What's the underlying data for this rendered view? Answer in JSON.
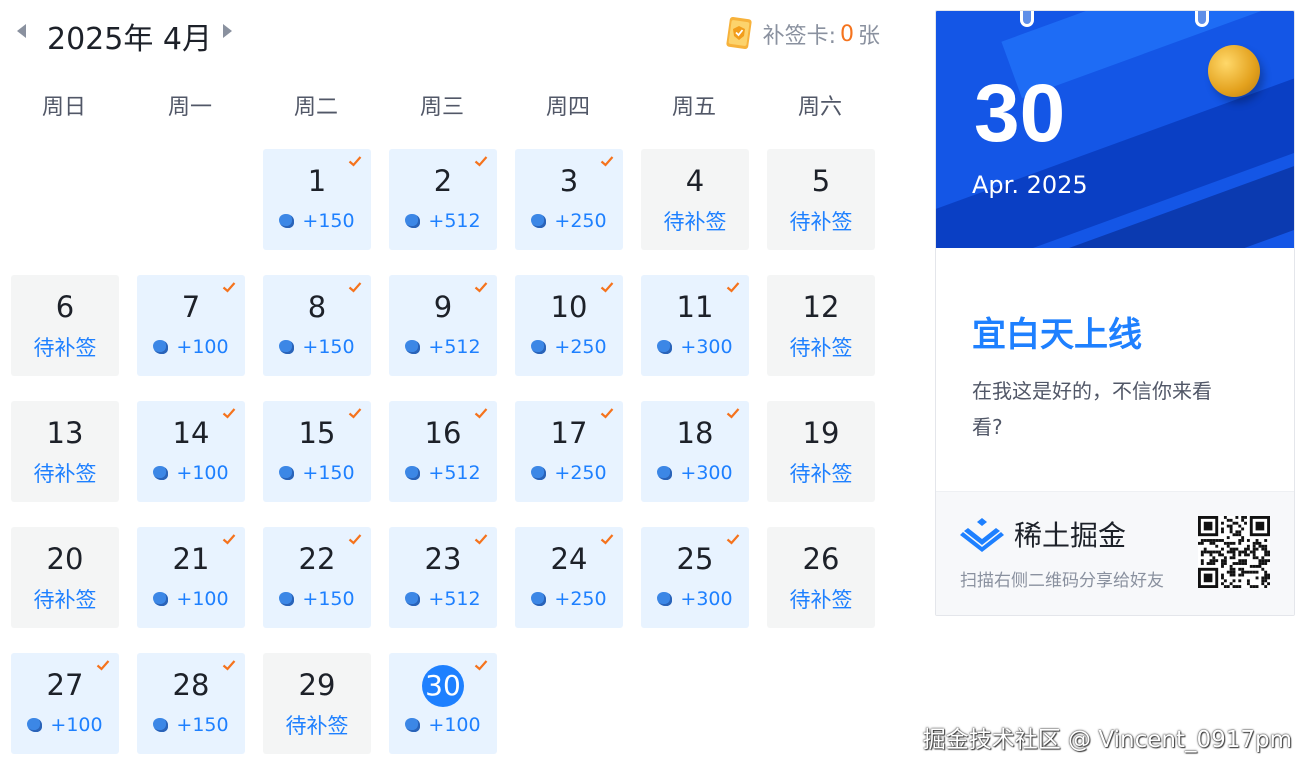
{
  "header": {
    "month_title": "2025年 4月",
    "makeup_label": "补签卡:",
    "makeup_count": "0",
    "makeup_unit": "张"
  },
  "weekdays": [
    "周日",
    "周一",
    "周二",
    "周三",
    "周四",
    "周五",
    "周六"
  ],
  "days": [
    {
      "day": "1",
      "status": "signed",
      "reward": "+150"
    },
    {
      "day": "2",
      "status": "signed",
      "reward": "+512"
    },
    {
      "day": "3",
      "status": "signed",
      "reward": "+250"
    },
    {
      "day": "4",
      "status": "pending",
      "label": "待补签"
    },
    {
      "day": "5",
      "status": "pending",
      "label": "待补签"
    },
    {
      "day": "6",
      "status": "pending",
      "label": "待补签"
    },
    {
      "day": "7",
      "status": "signed",
      "reward": "+100"
    },
    {
      "day": "8",
      "status": "signed",
      "reward": "+150"
    },
    {
      "day": "9",
      "status": "signed",
      "reward": "+512"
    },
    {
      "day": "10",
      "status": "signed",
      "reward": "+250"
    },
    {
      "day": "11",
      "status": "signed",
      "reward": "+300"
    },
    {
      "day": "12",
      "status": "pending",
      "label": "待补签"
    },
    {
      "day": "13",
      "status": "pending",
      "label": "待补签"
    },
    {
      "day": "14",
      "status": "signed",
      "reward": "+100"
    },
    {
      "day": "15",
      "status": "signed",
      "reward": "+150"
    },
    {
      "day": "16",
      "status": "signed",
      "reward": "+512"
    },
    {
      "day": "17",
      "status": "signed",
      "reward": "+250"
    },
    {
      "day": "18",
      "status": "signed",
      "reward": "+300"
    },
    {
      "day": "19",
      "status": "pending",
      "label": "待补签"
    },
    {
      "day": "20",
      "status": "pending",
      "label": "待补签"
    },
    {
      "day": "21",
      "status": "signed",
      "reward": "+100"
    },
    {
      "day": "22",
      "status": "signed",
      "reward": "+150"
    },
    {
      "day": "23",
      "status": "signed",
      "reward": "+512"
    },
    {
      "day": "24",
      "status": "signed",
      "reward": "+250"
    },
    {
      "day": "25",
      "status": "signed",
      "reward": "+300"
    },
    {
      "day": "26",
      "status": "pending",
      "label": "待补签"
    },
    {
      "day": "27",
      "status": "signed",
      "reward": "+100"
    },
    {
      "day": "28",
      "status": "signed",
      "reward": "+150"
    },
    {
      "day": "29",
      "status": "pending",
      "label": "待补签"
    },
    {
      "day": "30",
      "status": "signed",
      "reward": "+100",
      "today": true
    }
  ],
  "card": {
    "big_day": "30",
    "big_month": "Apr. 2025",
    "slogan": "宜白天上线",
    "description": "在我这是好的，不信你来看看?",
    "brand_name": "稀土掘金",
    "share_text": "扫描右侧二维码分享给好友"
  },
  "watermark": "掘金技术社区 @ Vincent_0917pm",
  "icons": {
    "prev": "chevron-left-icon",
    "next": "chevron-right-icon",
    "makeup_card": "makeup-card-icon",
    "ore": "ore-icon",
    "check": "check-icon",
    "brand": "juejin-logo-icon",
    "qr": "qr-code-icon"
  },
  "colors": {
    "accent": "#1e80ff",
    "signed_bg": "#e8f3ff",
    "pending_bg": "#f4f5f5",
    "check": "#f5731d",
    "makeup_count": "#f5731d"
  }
}
